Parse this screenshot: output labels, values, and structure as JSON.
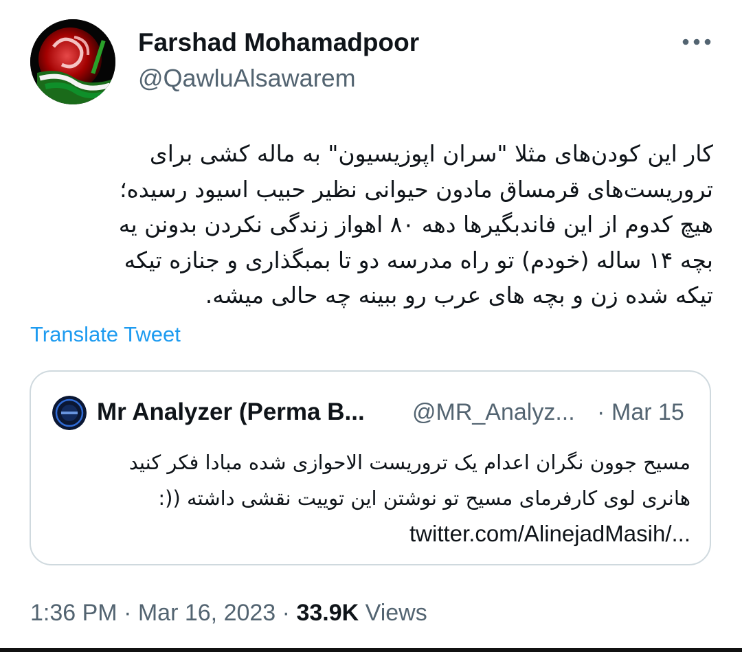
{
  "tweet": {
    "author": {
      "name": "Farshad Mohamadpoor",
      "handle": "@QawluAlsawarem",
      "avatar_icon": "iran-flag-emblem-avatar-icon"
    },
    "more_icon": "more-options-icon",
    "text_lines": [
      "کار این کودن‌های مثلا \"سران اپوزیسیون\" به ماله کشی برای",
      "تروریست‌های قرمساق مادون حیوانی نظیر حبیب اسیود رسیده؛",
      "هیچ کدوم از این فاندبگیرها دهه ۸۰ اهواز زندگی نکردن بدونن یه",
      "بچه ۱۴ ساله (خودم) تو راه مدرسه دو تا بمبگذاری و جنازه تیکه",
      "تیکه شده زن و بچه های عرب رو ببینه چه حالی میشه."
    ],
    "translate_label": "Translate Tweet",
    "quoted": {
      "name": "Mr Analyzer (Perma B...",
      "handle": "@MR_Analyz...",
      "separator": "·",
      "date": "Mar 15",
      "avatar_icon": "mr-analyzer-avatar-icon",
      "text_lines": [
        "مسیح جوون نگران اعدام یک تروریست الاحوازی شده مبادا فکر کنید",
        "هانری لوی کارفرمای مسیح تو نوشتن این توییت نقشی داشته ((:"
      ],
      "link": "twitter.com/AlinejadMasih/..."
    },
    "meta": {
      "time": "1:36 PM",
      "separator": "·",
      "date": "Mar 16, 2023",
      "views_count": "33.9K",
      "views_label": "Views"
    }
  },
  "colors": {
    "text_primary": "#0f1419",
    "text_secondary": "#536471",
    "link": "#1d9bf0",
    "border": "#cfd9de"
  }
}
